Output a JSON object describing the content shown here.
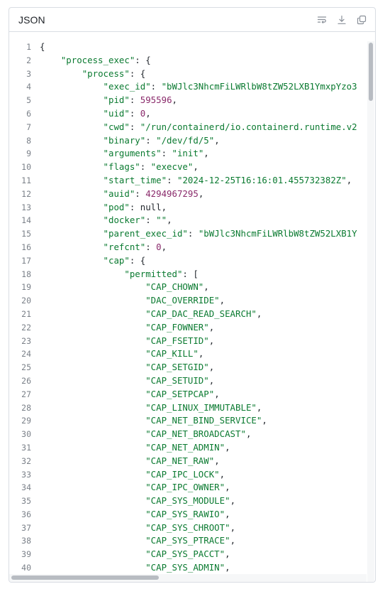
{
  "panel": {
    "title": "JSON",
    "actions": [
      {
        "name": "wrap-lines",
        "icon": "wrap-lines-icon"
      },
      {
        "name": "download",
        "icon": "download-icon"
      },
      {
        "name": "copy",
        "icon": "copy-icon"
      }
    ]
  },
  "code": {
    "lines": [
      {
        "num": "1",
        "indent": 0,
        "tokens": [
          {
            "t": "{",
            "c": "p"
          }
        ]
      },
      {
        "num": "2",
        "indent": 1,
        "tokens": [
          {
            "t": "\"process_exec\"",
            "c": "k"
          },
          {
            "t": ": {",
            "c": "p"
          }
        ]
      },
      {
        "num": "3",
        "indent": 2,
        "tokens": [
          {
            "t": "\"process\"",
            "c": "k"
          },
          {
            "t": ": {",
            "c": "p"
          }
        ]
      },
      {
        "num": "4",
        "indent": 3,
        "tokens": [
          {
            "t": "\"exec_id\"",
            "c": "k"
          },
          {
            "t": ": ",
            "c": "p"
          },
          {
            "t": "\"bWJlc3NhcmFiLWRlbW8tZW52LXB1YmxpYzo3",
            "c": "s"
          }
        ]
      },
      {
        "num": "5",
        "indent": 3,
        "tokens": [
          {
            "t": "\"pid\"",
            "c": "k"
          },
          {
            "t": ": ",
            "c": "p"
          },
          {
            "t": "595596",
            "c": "n"
          },
          {
            "t": ",",
            "c": "p"
          }
        ]
      },
      {
        "num": "6",
        "indent": 3,
        "tokens": [
          {
            "t": "\"uid\"",
            "c": "k"
          },
          {
            "t": ": ",
            "c": "p"
          },
          {
            "t": "0",
            "c": "n"
          },
          {
            "t": ",",
            "c": "p"
          }
        ]
      },
      {
        "num": "7",
        "indent": 3,
        "tokens": [
          {
            "t": "\"cwd\"",
            "c": "k"
          },
          {
            "t": ": ",
            "c": "p"
          },
          {
            "t": "\"/run/containerd/io.containerd.runtime.v2",
            "c": "s"
          }
        ]
      },
      {
        "num": "8",
        "indent": 3,
        "tokens": [
          {
            "t": "\"binary\"",
            "c": "k"
          },
          {
            "t": ": ",
            "c": "p"
          },
          {
            "t": "\"/dev/fd/5\"",
            "c": "s"
          },
          {
            "t": ",",
            "c": "p"
          }
        ]
      },
      {
        "num": "9",
        "indent": 3,
        "tokens": [
          {
            "t": "\"arguments\"",
            "c": "k"
          },
          {
            "t": ": ",
            "c": "p"
          },
          {
            "t": "\"init\"",
            "c": "s"
          },
          {
            "t": ",",
            "c": "p"
          }
        ]
      },
      {
        "num": "10",
        "indent": 3,
        "tokens": [
          {
            "t": "\"flags\"",
            "c": "k"
          },
          {
            "t": ": ",
            "c": "p"
          },
          {
            "t": "\"execve\"",
            "c": "s"
          },
          {
            "t": ",",
            "c": "p"
          }
        ]
      },
      {
        "num": "11",
        "indent": 3,
        "tokens": [
          {
            "t": "\"start_time\"",
            "c": "k"
          },
          {
            "t": ": ",
            "c": "p"
          },
          {
            "t": "\"2024-12-25T16:16:01.455732382Z\"",
            "c": "s"
          },
          {
            "t": ",",
            "c": "p"
          }
        ]
      },
      {
        "num": "12",
        "indent": 3,
        "tokens": [
          {
            "t": "\"auid\"",
            "c": "k"
          },
          {
            "t": ": ",
            "c": "p"
          },
          {
            "t": "4294967295",
            "c": "n"
          },
          {
            "t": ",",
            "c": "p"
          }
        ]
      },
      {
        "num": "13",
        "indent": 3,
        "tokens": [
          {
            "t": "\"pod\"",
            "c": "k"
          },
          {
            "t": ": ",
            "c": "p"
          },
          {
            "t": "null",
            "c": "kw"
          },
          {
            "t": ",",
            "c": "p"
          }
        ]
      },
      {
        "num": "14",
        "indent": 3,
        "tokens": [
          {
            "t": "\"docker\"",
            "c": "k"
          },
          {
            "t": ": ",
            "c": "p"
          },
          {
            "t": "\"\"",
            "c": "s"
          },
          {
            "t": ",",
            "c": "p"
          }
        ]
      },
      {
        "num": "15",
        "indent": 3,
        "tokens": [
          {
            "t": "\"parent_exec_id\"",
            "c": "k"
          },
          {
            "t": ": ",
            "c": "p"
          },
          {
            "t": "\"bWJlc3NhcmFiLWRlbW8tZW52LXB1Y",
            "c": "s"
          }
        ]
      },
      {
        "num": "16",
        "indent": 3,
        "tokens": [
          {
            "t": "\"refcnt\"",
            "c": "k"
          },
          {
            "t": ": ",
            "c": "p"
          },
          {
            "t": "0",
            "c": "n"
          },
          {
            "t": ",",
            "c": "p"
          }
        ]
      },
      {
        "num": "17",
        "indent": 3,
        "tokens": [
          {
            "t": "\"cap\"",
            "c": "k"
          },
          {
            "t": ": {",
            "c": "p"
          }
        ]
      },
      {
        "num": "18",
        "indent": 4,
        "tokens": [
          {
            "t": "\"permitted\"",
            "c": "k"
          },
          {
            "t": ": [",
            "c": "p"
          }
        ]
      },
      {
        "num": "19",
        "indent": 5,
        "tokens": [
          {
            "t": "\"CAP_CHOWN\"",
            "c": "s"
          },
          {
            "t": ",",
            "c": "p"
          }
        ]
      },
      {
        "num": "20",
        "indent": 5,
        "tokens": [
          {
            "t": "\"DAC_OVERRIDE\"",
            "c": "s"
          },
          {
            "t": ",",
            "c": "p"
          }
        ]
      },
      {
        "num": "21",
        "indent": 5,
        "tokens": [
          {
            "t": "\"CAP_DAC_READ_SEARCH\"",
            "c": "s"
          },
          {
            "t": ",",
            "c": "p"
          }
        ]
      },
      {
        "num": "22",
        "indent": 5,
        "tokens": [
          {
            "t": "\"CAP_FOWNER\"",
            "c": "s"
          },
          {
            "t": ",",
            "c": "p"
          }
        ]
      },
      {
        "num": "23",
        "indent": 5,
        "tokens": [
          {
            "t": "\"CAP_FSETID\"",
            "c": "s"
          },
          {
            "t": ",",
            "c": "p"
          }
        ]
      },
      {
        "num": "24",
        "indent": 5,
        "tokens": [
          {
            "t": "\"CAP_KILL\"",
            "c": "s"
          },
          {
            "t": ",",
            "c": "p"
          }
        ]
      },
      {
        "num": "25",
        "indent": 5,
        "tokens": [
          {
            "t": "\"CAP_SETGID\"",
            "c": "s"
          },
          {
            "t": ",",
            "c": "p"
          }
        ]
      },
      {
        "num": "26",
        "indent": 5,
        "tokens": [
          {
            "t": "\"CAP_SETUID\"",
            "c": "s"
          },
          {
            "t": ",",
            "c": "p"
          }
        ]
      },
      {
        "num": "27",
        "indent": 5,
        "tokens": [
          {
            "t": "\"CAP_SETPCAP\"",
            "c": "s"
          },
          {
            "t": ",",
            "c": "p"
          }
        ]
      },
      {
        "num": "28",
        "indent": 5,
        "tokens": [
          {
            "t": "\"CAP_LINUX_IMMUTABLE\"",
            "c": "s"
          },
          {
            "t": ",",
            "c": "p"
          }
        ]
      },
      {
        "num": "29",
        "indent": 5,
        "tokens": [
          {
            "t": "\"CAP_NET_BIND_SERVICE\"",
            "c": "s"
          },
          {
            "t": ",",
            "c": "p"
          }
        ]
      },
      {
        "num": "30",
        "indent": 5,
        "tokens": [
          {
            "t": "\"CAP_NET_BROADCAST\"",
            "c": "s"
          },
          {
            "t": ",",
            "c": "p"
          }
        ]
      },
      {
        "num": "31",
        "indent": 5,
        "tokens": [
          {
            "t": "\"CAP_NET_ADMIN\"",
            "c": "s"
          },
          {
            "t": ",",
            "c": "p"
          }
        ]
      },
      {
        "num": "32",
        "indent": 5,
        "tokens": [
          {
            "t": "\"CAP_NET_RAW\"",
            "c": "s"
          },
          {
            "t": ",",
            "c": "p"
          }
        ]
      },
      {
        "num": "33",
        "indent": 5,
        "tokens": [
          {
            "t": "\"CAP_IPC_LOCK\"",
            "c": "s"
          },
          {
            "t": ",",
            "c": "p"
          }
        ]
      },
      {
        "num": "34",
        "indent": 5,
        "tokens": [
          {
            "t": "\"CAP_IPC_OWNER\"",
            "c": "s"
          },
          {
            "t": ",",
            "c": "p"
          }
        ]
      },
      {
        "num": "35",
        "indent": 5,
        "tokens": [
          {
            "t": "\"CAP_SYS_MODULE\"",
            "c": "s"
          },
          {
            "t": ",",
            "c": "p"
          }
        ]
      },
      {
        "num": "36",
        "indent": 5,
        "tokens": [
          {
            "t": "\"CAP_SYS_RAWIO\"",
            "c": "s"
          },
          {
            "t": ",",
            "c": "p"
          }
        ]
      },
      {
        "num": "37",
        "indent": 5,
        "tokens": [
          {
            "t": "\"CAP_SYS_CHROOT\"",
            "c": "s"
          },
          {
            "t": ",",
            "c": "p"
          }
        ]
      },
      {
        "num": "38",
        "indent": 5,
        "tokens": [
          {
            "t": "\"CAP_SYS_PTRACE\"",
            "c": "s"
          },
          {
            "t": ",",
            "c": "p"
          }
        ]
      },
      {
        "num": "39",
        "indent": 5,
        "tokens": [
          {
            "t": "\"CAP_SYS_PACCT\"",
            "c": "s"
          },
          {
            "t": ",",
            "c": "p"
          }
        ]
      },
      {
        "num": "40",
        "indent": 5,
        "tokens": [
          {
            "t": "\"CAP_SYS_ADMIN\"",
            "c": "s"
          },
          {
            "t": ",",
            "c": "p"
          }
        ]
      }
    ]
  },
  "colors": {
    "key": "#0a7a30",
    "string": "#0a7a30",
    "number": "#8a2a6b",
    "punctuation": "#24292f",
    "line_number": "#7b8189",
    "border": "#d9dde3"
  }
}
